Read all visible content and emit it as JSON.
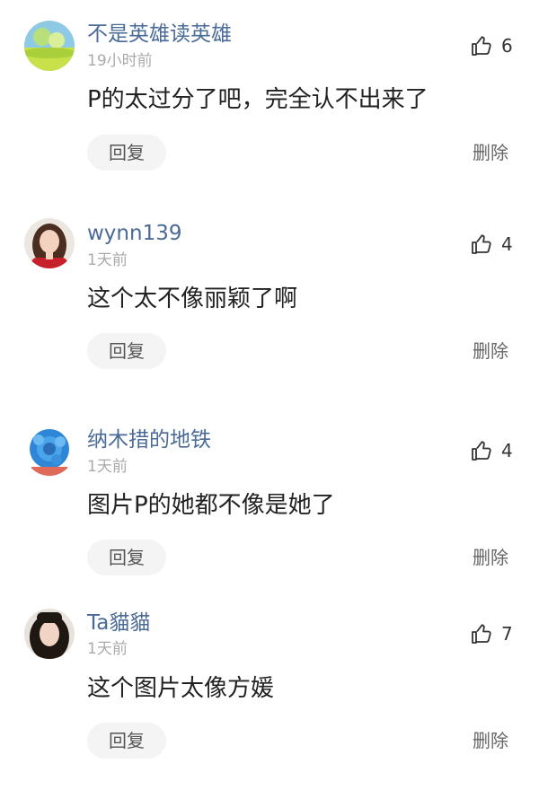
{
  "comments": [
    {
      "username": "不是英雄读英雄",
      "time": "19小时前",
      "content": "P的太过分了吧，完全认不出来了",
      "likes": "6",
      "reply_label": "回复",
      "delete_label": "删除"
    },
    {
      "username": "wynn139",
      "time": "1天前",
      "content": "这个太不像丽颖了啊",
      "likes": "4",
      "reply_label": "回复",
      "delete_label": "删除"
    },
    {
      "username": "纳木措的地铁",
      "time": "1天前",
      "content": "图片P的她都不像是她了",
      "likes": "4",
      "reply_label": "回复",
      "delete_label": "删除"
    },
    {
      "username": "Ta貓貓",
      "time": "1天前",
      "content": "这个图片太像方媛",
      "likes": "7",
      "reply_label": "回复",
      "delete_label": "删除"
    }
  ],
  "icons": {
    "like": "thumbs-up-icon"
  },
  "colors": {
    "username": "#4a6a97",
    "timestamp": "#aaaaaa",
    "reply_bg": "#f4f4f4"
  }
}
